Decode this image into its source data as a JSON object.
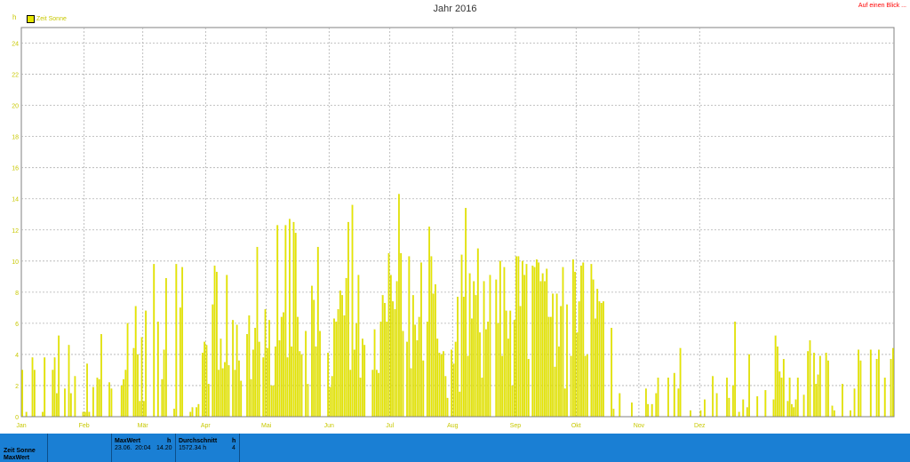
{
  "title": "Jahr 2016",
  "link_text": "Auf einen Blick ...",
  "unit": "h",
  "colors": {
    "bar": "#e6e600",
    "bar_stroke": "#c8c800",
    "axis_text": "#c8c800",
    "grid": "#b0b0b0",
    "footer_bg": "#1a7fd4",
    "link": "#ff0000"
  },
  "chart_data": {
    "type": "bar",
    "title": "Jahr 2016",
    "ylabel": "h",
    "ylim": [
      0,
      25
    ],
    "yticks": [
      0,
      2,
      4,
      6,
      8,
      10,
      12,
      14,
      16,
      18,
      20,
      22,
      24
    ],
    "x_tick_labels": [
      "Jan",
      "Feb",
      "Mär",
      "Apr",
      "Mai",
      "Jun",
      "Jul",
      "Aug",
      "Sep",
      "Okt",
      "Nov",
      "Dez"
    ],
    "month_days": [
      31,
      29,
      31,
      30,
      31,
      30,
      31,
      31,
      30,
      31,
      30,
      31
    ],
    "grid": true,
    "legend": "top-left",
    "series": [
      {
        "name": "Zeit Sonne",
        "values": [
          3.0,
          0.0,
          0.3,
          0.0,
          0.0,
          3.8,
          3.0,
          0.0,
          0.0,
          0.0,
          0.3,
          3.8,
          0.0,
          0.0,
          0.0,
          3.0,
          3.8,
          1.5,
          5.2,
          0.0,
          0.0,
          1.8,
          0.0,
          4.6,
          1.5,
          0.0,
          2.6,
          0.0,
          0.0,
          0.0,
          0.3,
          0.3,
          3.4,
          0.3,
          0.0,
          1.9,
          0.0,
          2.5,
          2.4,
          5.3,
          0.0,
          0.0,
          0.0,
          2.2,
          1.8,
          0.0,
          0.0,
          0.0,
          0.0,
          2.0,
          2.4,
          3.0,
          6.0,
          0.0,
          0.0,
          4.4,
          7.1,
          4.0,
          1.0,
          5.1,
          1.0,
          6.8,
          0.0,
          0.0,
          0.0,
          9.8,
          0.0,
          6.1,
          0.0,
          2.4,
          4.3,
          8.9,
          0.0,
          0.0,
          0.0,
          0.5,
          9.8,
          0.0,
          7.0,
          9.6,
          0.0,
          0.0,
          0.0,
          0.3,
          0.6,
          0.0,
          0.6,
          0.8,
          0.0,
          4.1,
          4.8,
          4.6,
          2.1,
          0.0,
          7.2,
          9.7,
          9.3,
          3.0,
          5.0,
          3.1,
          3.5,
          9.1,
          3.3,
          0.0,
          6.2,
          3.0,
          5.9,
          3.6,
          2.3,
          0.0,
          0.0,
          5.3,
          6.5,
          2.4,
          4.3,
          5.7,
          10.9,
          4.8,
          0.0,
          3.8,
          6.9,
          4.4,
          6.2,
          2.0,
          2.0,
          4.5,
          12.3,
          4.9,
          6.4,
          6.7,
          12.3,
          3.8,
          12.7,
          4.5,
          12.5,
          11.8,
          6.4,
          4.2,
          4.0,
          0.0,
          5.5,
          2.1,
          0.0,
          8.4,
          7.5,
          4.5,
          10.9,
          5.5,
          0.0,
          0.0,
          0.0,
          4.1,
          1.9,
          2.6,
          6.3,
          6.1,
          6.9,
          8.1,
          7.8,
          6.5,
          8.9,
          12.5,
          3.0,
          13.6,
          4.3,
          6.0,
          9.1,
          2.5,
          5.0,
          4.6,
          0.0,
          0.0,
          0.0,
          3.0,
          5.6,
          3.0,
          2.8,
          6.1,
          7.8,
          7.3,
          6.1,
          10.5,
          9.1,
          7.4,
          6.9,
          8.7,
          14.3,
          10.5,
          5.5,
          0.0,
          4.8,
          10.3,
          3.1,
          7.8,
          5.9,
          4.9,
          6.4,
          9.9,
          3.6,
          0.0,
          6.1,
          12.2,
          10.3,
          7.9,
          8.5,
          5.0,
          4.1,
          4.0,
          4.2,
          2.6,
          1.2,
          0.0,
          4.3,
          3.4,
          4.8,
          7.7,
          1.6,
          10.4,
          7.7,
          13.4,
          3.9,
          9.2,
          6.3,
          8.7,
          7.8,
          10.8,
          5.4,
          2.5,
          8.7,
          5.6,
          6.1,
          9.1,
          0.0,
          0.0,
          8.8,
          6.0,
          10.0,
          3.9,
          9.6,
          6.8,
          5.0,
          6.8,
          2.0,
          6.2,
          10.3,
          10.3,
          7.1,
          10.0,
          9.1,
          9.8,
          3.7,
          0.0,
          9.7,
          9.6,
          10.1,
          9.9,
          8.7,
          9.2,
          8.7,
          9.5,
          6.4,
          6.4,
          7.9,
          3.2,
          7.9,
          4.5,
          7.1,
          9.6,
          1.8,
          7.2,
          0.0,
          3.9,
          10.1,
          9.3,
          5.4,
          7.4,
          9.7,
          9.9,
          3.9,
          4.0,
          0.0,
          9.8,
          8.8,
          6.3,
          8.2,
          7.4,
          7.3,
          7.4,
          0.0,
          0.0,
          0.0,
          5.7,
          0.5,
          0.0,
          0.0,
          1.5,
          0.0,
          0.0,
          0.0,
          0.0,
          0.0,
          0.9,
          0.0,
          0.0,
          0.0,
          0.0,
          0.0,
          0.0,
          1.8,
          0.8,
          0.0,
          0.8,
          0.0,
          1.5,
          2.5,
          0.0,
          0.0,
          0.0,
          0.0,
          2.5,
          0.0,
          0.0,
          2.8,
          0.0,
          1.8,
          4.4,
          0.0,
          0.0,
          0.0,
          0.0,
          0.4,
          0.0,
          0.0,
          0.0,
          0.0,
          0.4,
          0.0,
          1.1,
          0.0,
          0.0,
          0.0,
          2.6,
          0.0,
          1.5,
          0.0,
          0.0,
          0.0,
          0.0,
          2.5,
          1.2,
          0.0,
          2.0,
          6.1,
          0.0,
          0.3,
          0.0,
          1.1,
          0.0,
          0.6,
          4.0,
          0.0,
          0.0,
          0.0,
          1.3,
          0.0,
          0.0,
          0.0,
          1.7,
          0.0,
          0.0,
          0.0,
          1.1,
          5.2,
          4.5,
          2.9,
          2.5,
          3.7,
          0.0,
          1.0,
          2.5,
          0.8,
          0.6,
          1.1,
          2.5,
          0.0,
          0.0,
          1.4,
          0.0,
          4.2,
          4.9,
          0.0,
          4.1,
          2.1,
          2.7,
          3.9,
          0.0,
          0.0,
          4.1,
          3.6,
          0.0,
          0.7,
          0.4,
          0.0,
          0.0,
          0.0,
          2.1,
          0.0,
          0.0,
          0.0,
          0.4,
          0.0,
          1.8,
          0.0,
          4.3,
          3.6,
          0.0,
          0.0,
          0.0,
          0.0,
          4.3,
          0.0,
          0.0,
          3.7,
          4.3,
          0.0,
          0.0,
          2.5,
          0.0,
          0.0,
          3.7,
          4.4
        ]
      }
    ]
  },
  "footer": {
    "row_label_1": "Zeit Sonne",
    "row_label_2": "MaxWert",
    "maxwert_header": "MaxWert",
    "maxwert_unit": "h",
    "maxwert_date": "23.06.",
    "maxwert_time": "20:04",
    "maxwert_value": "14.20",
    "durchschnitt_header": "Durchschnitt",
    "durchschnitt_unit": "h",
    "durchschnitt_value": "1572.34 h",
    "durchschnitt_extra": "4"
  }
}
